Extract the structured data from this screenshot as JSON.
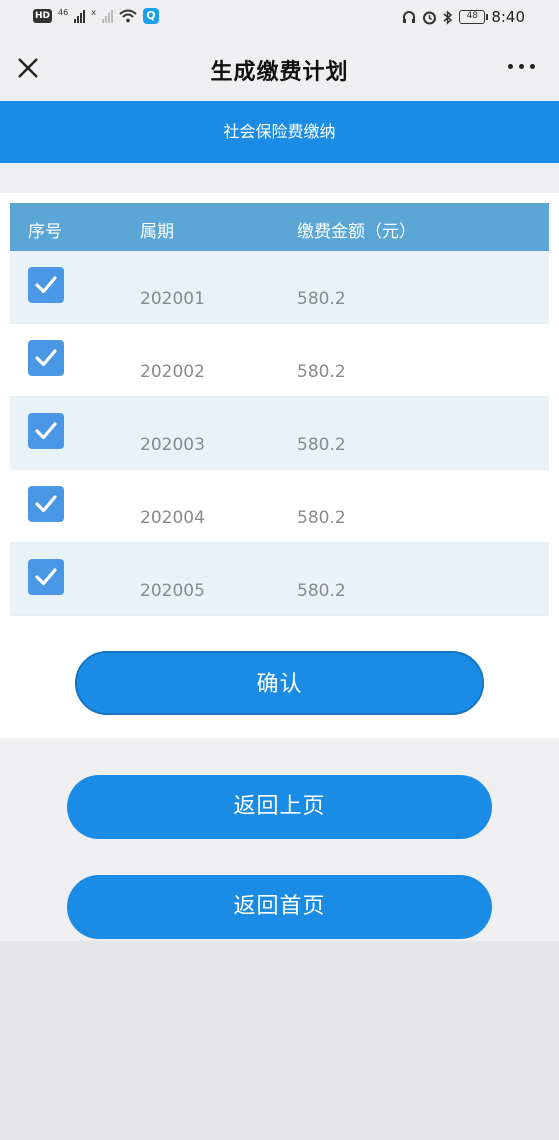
{
  "status_bar": {
    "hd_label": "HD",
    "network_label": "46",
    "network_label_2": "x",
    "battery": "48",
    "time": "8:40"
  },
  "header": {
    "title": "生成缴费计划"
  },
  "banner": {
    "text": "社会保险费缴纳"
  },
  "table": {
    "columns": [
      "序号",
      "属期",
      "缴费金额（元）"
    ],
    "rows": [
      {
        "checked": true,
        "period": "202001",
        "amount": "580.2"
      },
      {
        "checked": true,
        "period": "202002",
        "amount": "580.2"
      },
      {
        "checked": true,
        "period": "202003",
        "amount": "580.2"
      },
      {
        "checked": true,
        "period": "202004",
        "amount": "580.2"
      },
      {
        "checked": true,
        "period": "202005",
        "amount": "580.2"
      }
    ]
  },
  "buttons": {
    "confirm": "确认",
    "back": "返回上页",
    "home": "返回首页"
  },
  "colors": {
    "primary": "#1b8ce6",
    "table_header": "#5aa6d6",
    "row_shade": "#e9f2f6",
    "checkbox": "#4a97e6"
  }
}
